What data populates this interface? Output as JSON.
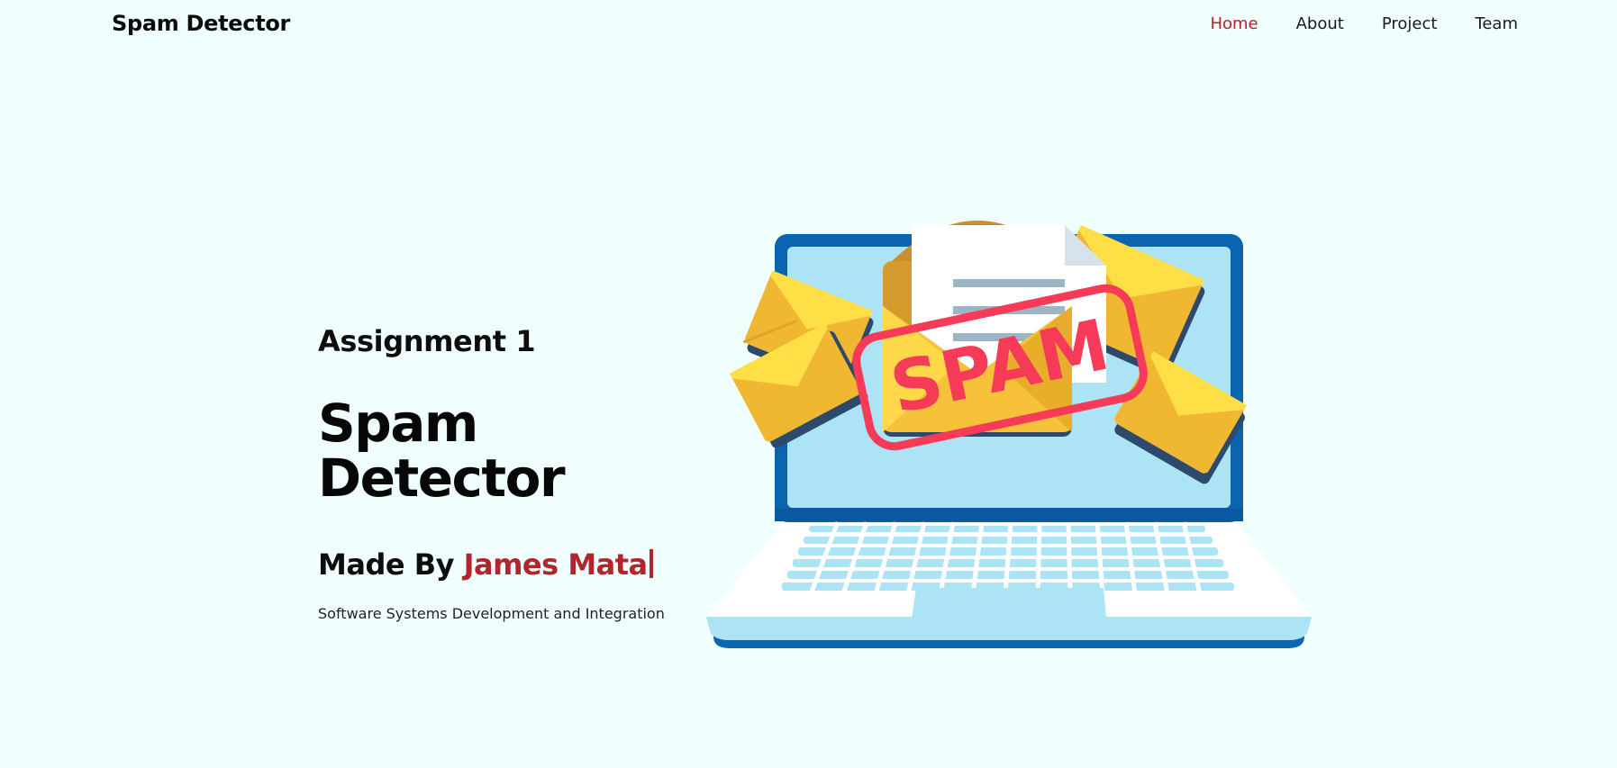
{
  "nav": {
    "brand": "Spam Detector",
    "links": [
      {
        "label": "Home",
        "active": true
      },
      {
        "label": "About",
        "active": false
      },
      {
        "label": "Project",
        "active": false
      },
      {
        "label": "Team",
        "active": false
      }
    ]
  },
  "hero": {
    "subtitle": "Assignment 1",
    "title": "Spam Detector",
    "made_by_prefix": "Made By",
    "author": "James Mata",
    "course": "Software Systems Development and Integration"
  },
  "illustration": {
    "stamp_text": "SPAM",
    "icons": [
      "laptop-icon",
      "envelope-icon",
      "letter-icon",
      "spam-stamp-icon"
    ]
  },
  "colors": {
    "background": "#f0fffe",
    "accent": "#b0262c",
    "laptop_frame": "#0b64b0",
    "screen": "#ace3f5",
    "envelope": "#f5c23a",
    "stamp": "#f53b57"
  }
}
